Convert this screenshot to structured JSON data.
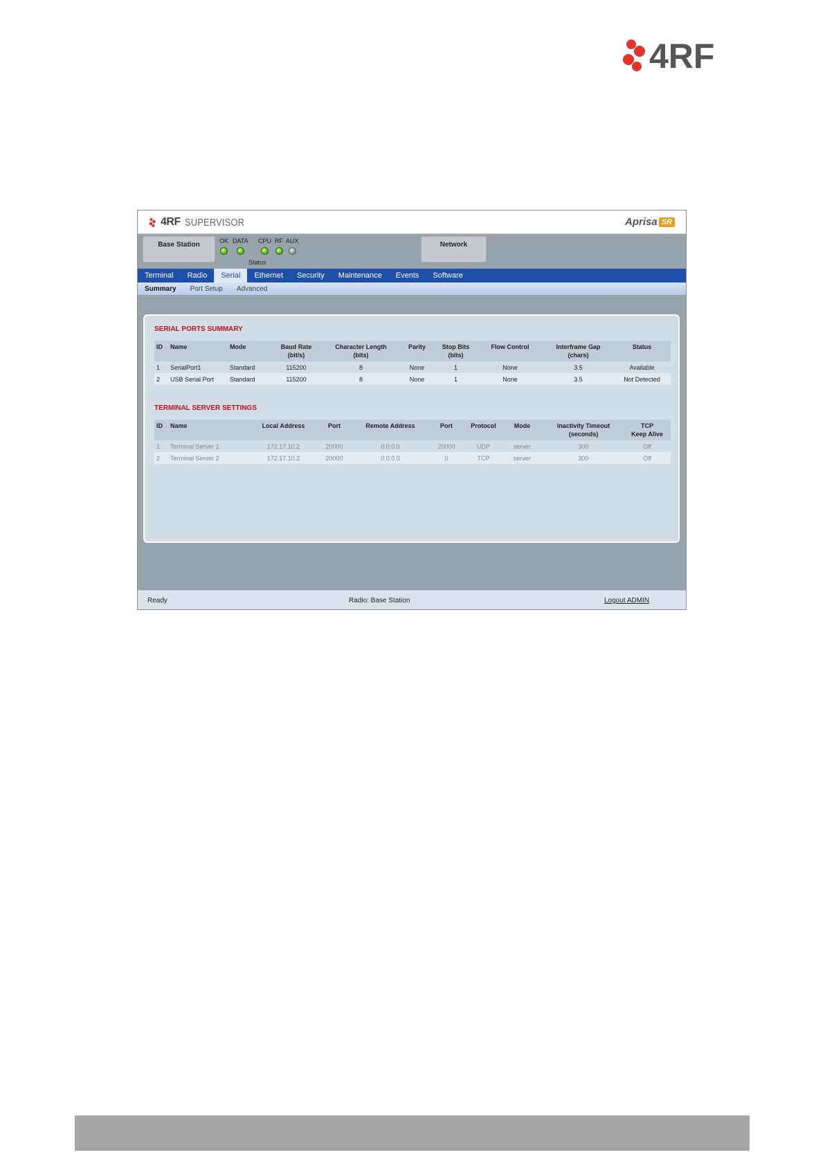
{
  "header": {
    "window_brand": "4RF",
    "window_brand_sub": "SUPERVISOR",
    "product": "Aprisa",
    "product_badge": "SR"
  },
  "panels": {
    "base_station": "Base Station",
    "network": "Network"
  },
  "status": {
    "label": "Status",
    "leds": [
      {
        "name": "OK",
        "on": true
      },
      {
        "name": "DATA",
        "on": true
      },
      {
        "name": "CPU",
        "on": true
      },
      {
        "name": "RF",
        "on": true
      },
      {
        "name": "AUX",
        "on": false
      }
    ]
  },
  "nav": {
    "tabs": [
      "Terminal",
      "Radio",
      "Serial",
      "Ethernet",
      "Security",
      "Maintenance",
      "Events",
      "Software"
    ],
    "active": "Serial",
    "subtabs": [
      "Summary",
      "Port Setup",
      "Advanced"
    ],
    "active_sub": "Summary"
  },
  "serial_summary": {
    "title": "SERIAL PORTS SUMMARY",
    "headers": [
      "ID",
      "Name",
      "Mode",
      "Baud Rate\n(bit/s)",
      "Character Length\n(bits)",
      "Parity",
      "Stop Bits\n(bits)",
      "Flow Control",
      "Interframe Gap\n(chars)",
      "Status"
    ],
    "rows": [
      [
        "1",
        "SerialPort1",
        "Standard",
        "115200",
        "8",
        "None",
        "1",
        "None",
        "3.5",
        "Available"
      ],
      [
        "2",
        "USB Serial Port",
        "Standard",
        "115200",
        "8",
        "None",
        "1",
        "None",
        "3.5",
        "Not Detected"
      ]
    ]
  },
  "terminal_server": {
    "title": "TERMINAL SERVER SETTINGS",
    "headers": [
      "ID",
      "Name",
      "Local Address",
      "Port",
      "Remote Address",
      "Port",
      "Protocol",
      "Mode",
      "Inactivity Timeout\n(seconds)",
      "TCP\nKeep Alive"
    ],
    "rows": [
      [
        "1",
        "Terminal Server 1",
        "172.17.10.2",
        "20000",
        "0.0.0.0",
        "20000",
        "UDP",
        "server",
        "300",
        "Off"
      ],
      [
        "2",
        "Terminal Server 2",
        "172.17.10.2",
        "20000",
        "0.0.0.0",
        "0",
        "TCP",
        "server",
        "300",
        "Off"
      ]
    ]
  },
  "statusbar": {
    "left": "Ready",
    "center": "Radio: Base Station",
    "right": "Logout ADMIN"
  },
  "colors": {
    "brand_red": "#e63329",
    "nav_blue": "#1f4fa8",
    "section_title": "#c0101c"
  }
}
